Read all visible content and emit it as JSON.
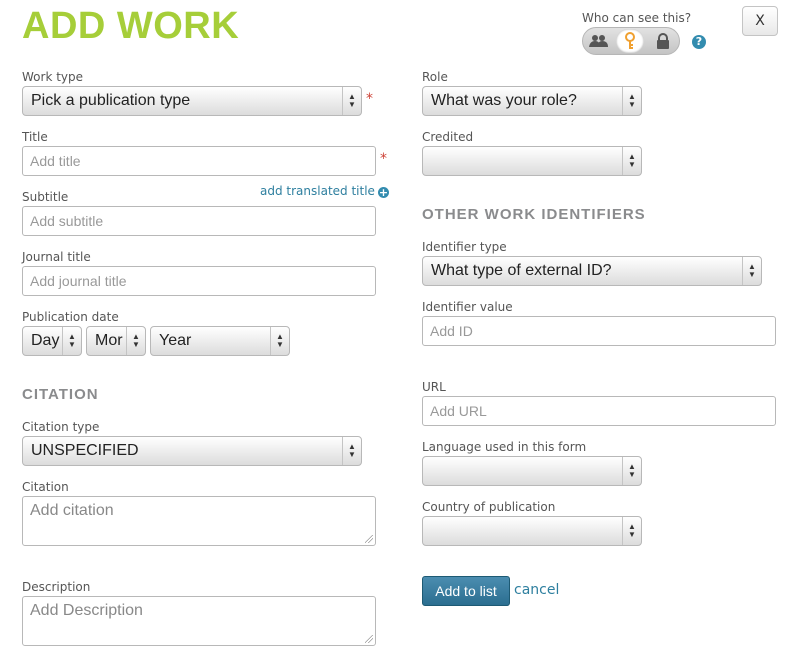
{
  "header": {
    "title": "ADD WORK",
    "visibility_label": "Who can see this?",
    "visibility_options": [
      {
        "name": "everyone",
        "icon": "group-icon"
      },
      {
        "name": "trusted-parties",
        "icon": "key-icon",
        "selected": true
      },
      {
        "name": "only-me",
        "icon": "lock-icon"
      }
    ],
    "help_icon": "question-icon",
    "help_glyph": "?",
    "close_label": "X"
  },
  "required_marker": "*",
  "form_left": {
    "work_type": {
      "label": "Work type",
      "value": "Pick a publication type"
    },
    "title": {
      "label": "Title",
      "placeholder": "Add title"
    },
    "add_translated_title": "add translated title",
    "subtitle": {
      "label": "Subtitle",
      "placeholder": "Add subtitle"
    },
    "journal_title": {
      "label": "Journal title",
      "placeholder": "Add journal title"
    },
    "publication_date": {
      "label": "Publication date",
      "day": "Day",
      "month": "Mor",
      "year": "Year"
    },
    "citation_section": "CITATION",
    "citation_type": {
      "label": "Citation type",
      "value": "UNSPECIFIED"
    },
    "citation": {
      "label": "Citation",
      "placeholder": "Add citation"
    },
    "description": {
      "label": "Description",
      "placeholder": "Add Description"
    }
  },
  "form_right": {
    "role": {
      "label": "Role",
      "value": "What was your role?"
    },
    "credited": {
      "label": "Credited",
      "value": ""
    },
    "identifiers_section": "OTHER WORK IDENTIFIERS",
    "identifier_type": {
      "label": "Identifier type",
      "value": "What type of external ID?"
    },
    "identifier_value": {
      "label": "Identifier value",
      "placeholder": "Add ID"
    },
    "url": {
      "label": "URL",
      "placeholder": "Add URL"
    },
    "language": {
      "label": "Language used in this form",
      "value": ""
    },
    "country": {
      "label": "Country of publication",
      "value": ""
    }
  },
  "actions": {
    "add_label": "Add to list",
    "cancel_label": "cancel"
  },
  "colors": {
    "title": "#a6ce39",
    "link": "#2e7f9f",
    "primary_button": "#2b6e90",
    "required": "#cd4236"
  }
}
